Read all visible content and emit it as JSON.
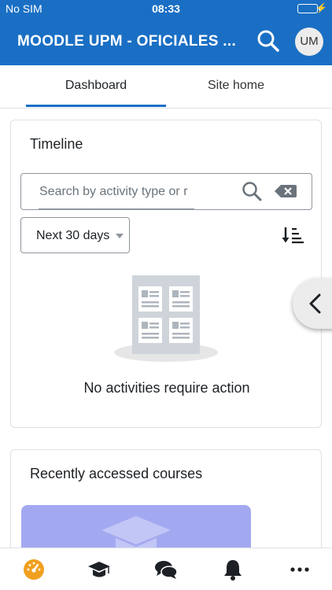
{
  "status_bar": {
    "carrier": "No SIM",
    "time": "08:33",
    "battery_color": "#4cd964"
  },
  "app_bar": {
    "title": "MOODLE UPM - OFICIALES ...",
    "avatar_initials": "UM",
    "color": "#1a6fc4"
  },
  "tabs": [
    {
      "label": "Dashboard",
      "active": true
    },
    {
      "label": "Site home",
      "active": false
    }
  ],
  "timeline": {
    "title": "Timeline",
    "search_placeholder": "Search by activity type or r",
    "filter_value": "Next 30 days",
    "empty_message": "No activities require action"
  },
  "recent_courses": {
    "title": "Recently accessed courses",
    "thumb_color": "#a3a9f0"
  },
  "icons": {
    "search": "search-icon",
    "clear": "backspace-icon",
    "sort": "sort-icon",
    "drawer": "chevron-left-icon",
    "nav": [
      "dashboard-icon",
      "graduation-cap-icon",
      "comments-icon",
      "bell-icon",
      "more-icon"
    ]
  },
  "accent_color": "#f0a020"
}
